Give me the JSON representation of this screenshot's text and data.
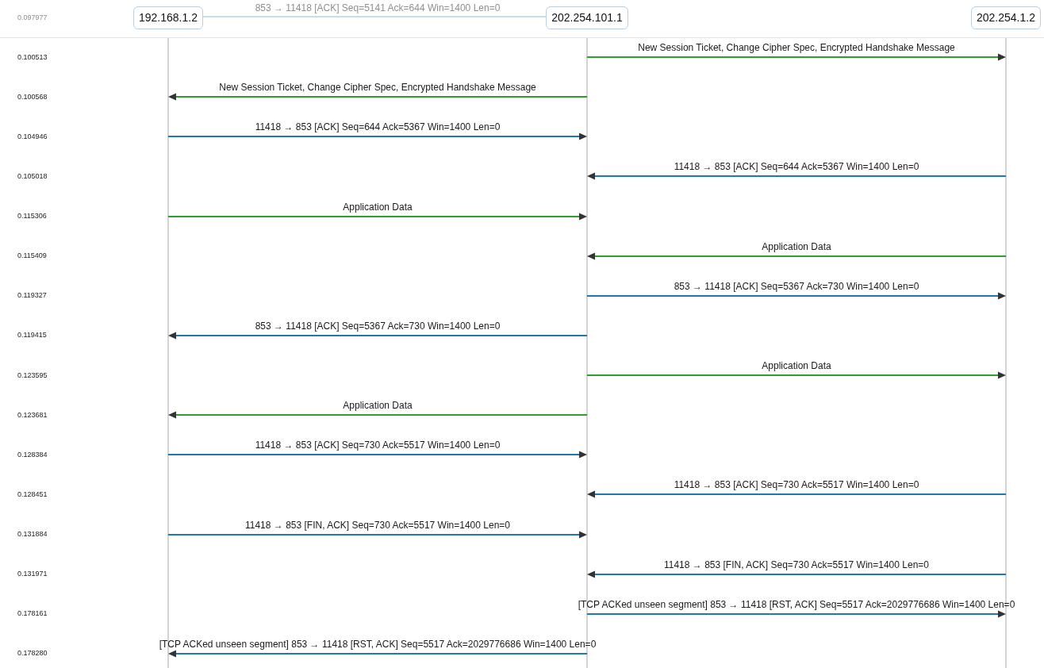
{
  "header": {
    "hosts": [
      "192.168.1.2",
      "202.254.101.1",
      "202.254.1.2"
    ],
    "scrolled_message": {
      "time": "0.097977",
      "label": "853 → 11418 [ACK] Seq=5141 Ack=644 Win=1400 Len=0",
      "kind": "left"
    }
  },
  "messages": [
    {
      "time": "0.100513",
      "label": "New Session Ticket, Change Cipher Spec, Encrypted Handshake Message",
      "kind": "right",
      "rightward": true,
      "color": "#2ca02c"
    },
    {
      "time": "0.100568",
      "label": "New Session Ticket, Change Cipher Spec, Encrypted Handshake Message",
      "kind": "left",
      "rightward": false,
      "color": "#2ca02c"
    },
    {
      "time": "0.104946",
      "label": "11418 → 853 [ACK] Seq=644 Ack=5367 Win=1400 Len=0",
      "kind": "left",
      "rightward": true,
      "color": "#1f77b4"
    },
    {
      "time": "0.105018",
      "label": "11418 → 853 [ACK] Seq=644 Ack=5367 Win=1400 Len=0",
      "kind": "right",
      "rightward": false,
      "color": "#1f77b4"
    },
    {
      "time": "0.115306",
      "label": "Application Data",
      "kind": "left",
      "rightward": true,
      "color": "#2ca02c"
    },
    {
      "time": "0.115409",
      "label": "Application Data",
      "kind": "right",
      "rightward": false,
      "color": "#2ca02c"
    },
    {
      "time": "0.119327",
      "label": "853 → 11418 [ACK] Seq=5367 Ack=730 Win=1400 Len=0",
      "kind": "right",
      "rightward": true,
      "color": "#1f77b4"
    },
    {
      "time": "0.119415",
      "label": "853 → 11418 [ACK] Seq=5367 Ack=730 Win=1400 Len=0",
      "kind": "left",
      "rightward": false,
      "color": "#1f77b4"
    },
    {
      "time": "0.123595",
      "label": "Application Data",
      "kind": "right",
      "rightward": true,
      "color": "#2ca02c"
    },
    {
      "time": "0.123681",
      "label": "Application Data",
      "kind": "left",
      "rightward": false,
      "color": "#2ca02c"
    },
    {
      "time": "0.128384",
      "label": "11418 → 853 [ACK] Seq=730 Ack=5517 Win=1400 Len=0",
      "kind": "left",
      "rightward": true,
      "color": "#1f77b4"
    },
    {
      "time": "0.128451",
      "label": "11418 → 853 [ACK] Seq=730 Ack=5517 Win=1400 Len=0",
      "kind": "right",
      "rightward": false,
      "color": "#1f77b4"
    },
    {
      "time": "0.131884",
      "label": "11418 → 853 [FIN, ACK] Seq=730 Ack=5517 Win=1400 Len=0",
      "kind": "left",
      "rightward": true,
      "color": "#1f77b4"
    },
    {
      "time": "0.131971",
      "label": "11418 → 853 [FIN, ACK] Seq=730 Ack=5517 Win=1400 Len=0",
      "kind": "right",
      "rightward": false,
      "color": "#1f77b4"
    },
    {
      "time": "0.178161",
      "label": "[TCP ACKed unseen segment] 853 → 11418 [RST, ACK] Seq=5517 Ack=2029776686 Win=1400 Len=0",
      "kind": "right",
      "rightward": true,
      "color": "#1f77b4"
    },
    {
      "time": "0.178280",
      "label": "[TCP ACKed unseen segment] 853 → 11418 [RST, ACK] Seq=5517 Ack=2029776686 Win=1400 Len=0",
      "kind": "left",
      "rightward": false,
      "color": "#1f77b4"
    }
  ]
}
